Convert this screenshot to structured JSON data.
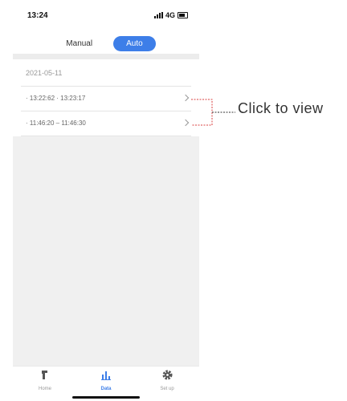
{
  "status_bar": {
    "time": "13:24",
    "network": "4G"
  },
  "tabs": [
    {
      "label": "Manual",
      "active": false
    },
    {
      "label": "Auto",
      "active": true
    }
  ],
  "date_header": "2021-05-11",
  "records": [
    {
      "label": "· 13:22:62 · 13:23:17"
    },
    {
      "label": "· 11:46:20 – 11:46:30"
    }
  ],
  "callout": {
    "text": "Click to view",
    "color": "#d94040"
  },
  "bottom_nav": [
    {
      "label": "Home",
      "icon": "home-icon",
      "active": false
    },
    {
      "label": "Data",
      "icon": "bar-chart-icon",
      "active": true
    },
    {
      "label": "Set up",
      "icon": "gear-icon",
      "active": false
    }
  ],
  "colors": {
    "accent": "#3d7ee8",
    "background_gray": "#f0f0f0"
  }
}
